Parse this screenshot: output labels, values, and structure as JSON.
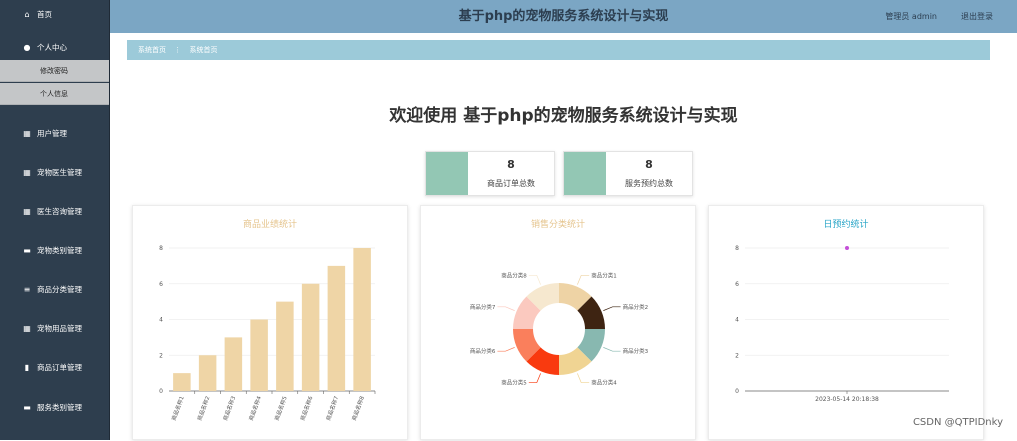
{
  "app": {
    "title": "基于php的宠物服务系统设计与实现",
    "user_text": "管理员 admin",
    "logout_label": "退出登录"
  },
  "sidebar": {
    "items": [
      {
        "label": "首页",
        "icon": "home-icon"
      },
      {
        "label": "个人中心",
        "icon": "user-icon"
      },
      {
        "label": "用户管理",
        "icon": "grid-icon"
      },
      {
        "label": "宠物医生管理",
        "icon": "grid-icon"
      },
      {
        "label": "医生咨询管理",
        "icon": "grid-icon"
      },
      {
        "label": "宠物类别管理",
        "icon": "comment-icon"
      },
      {
        "label": "商品分类管理",
        "icon": "list-icon"
      },
      {
        "label": "宠物用品管理",
        "icon": "grid-icon"
      },
      {
        "label": "商品订单管理",
        "icon": "clipboard-icon"
      },
      {
        "label": "服务类别管理",
        "icon": "monitor-icon"
      }
    ],
    "sub_items": [
      {
        "label": "修改密码"
      },
      {
        "label": "个人信息"
      }
    ]
  },
  "breadcrumb": {
    "home": "系统首页",
    "separator": "⋮",
    "current": "系统首页"
  },
  "welcome": "欢迎使用 基于php的宠物服务系统设计与实现",
  "stats": [
    {
      "value": "8",
      "label": "商品订单总数"
    },
    {
      "value": "8",
      "label": "服务预约总数"
    }
  ],
  "colors": {
    "sidebar_bg": "#2e3e4e",
    "topbar_bg": "#7ba6c4",
    "crumb_bg": "#9ccad9",
    "stat_accent": "#93c7b4",
    "bar_fill": "#efd5a6"
  },
  "chart_data": [
    {
      "type": "bar",
      "title": "商品业绩统计",
      "title_color": "#e5c48d",
      "categories": [
        "商品名称1",
        "商品名称2",
        "商品名称3",
        "商品名称4",
        "商品名称5",
        "商品名称6",
        "商品名称7",
        "商品名称8"
      ],
      "values": [
        1,
        2,
        3,
        4,
        5,
        6,
        7,
        8
      ],
      "ylim": [
        0,
        8
      ],
      "yticks": [
        0,
        2,
        4,
        6,
        8
      ],
      "color": "#efd5a6"
    },
    {
      "type": "pie",
      "title": "销售分类统计",
      "title_color": "#e5c48d",
      "donut": true,
      "labels": [
        "商品分类1",
        "商品分类2",
        "商品分类3",
        "商品分类4",
        "商品分类5",
        "商品分类6",
        "商品分类7",
        "商品分类8"
      ],
      "values": [
        1,
        1,
        1,
        1,
        1,
        1,
        1,
        1
      ],
      "colors": [
        "#eed3a5",
        "#3e2412",
        "#88b8b0",
        "#f0d493",
        "#f93a0f",
        "#fa7f5c",
        "#fbc9bf",
        "#f6e8cf"
      ]
    },
    {
      "type": "scatter",
      "title": "日预约统计",
      "title_color": "#2aa6c8",
      "x": [
        "2023-05-14 20:18:38"
      ],
      "y": [
        8
      ],
      "ylim": [
        0,
        8
      ],
      "yticks": [
        0,
        2,
        4,
        6,
        8
      ],
      "color": "#c44fd8"
    }
  ],
  "watermark": "CSDN @QTPIDnky"
}
